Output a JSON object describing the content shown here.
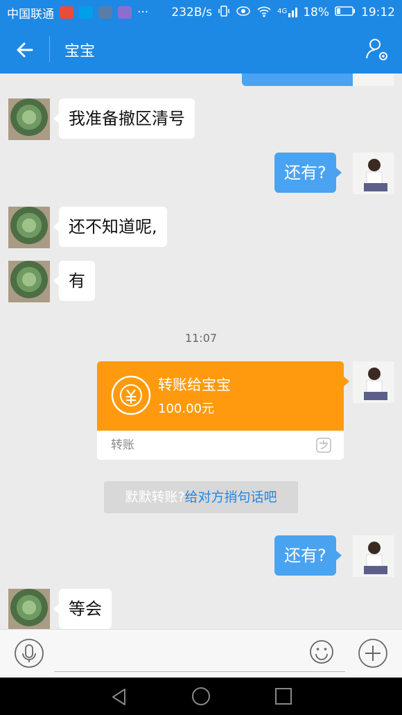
{
  "status_bar": {
    "carrier": "中国联通",
    "speed": "232B/s",
    "network": "4G",
    "battery": "18%",
    "time": "19:12",
    "more": "···"
  },
  "header": {
    "title": "宝宝"
  },
  "messages": [
    {
      "side": "left",
      "text": "我准备撤区清号"
    },
    {
      "side": "right",
      "text": "还有?"
    },
    {
      "side": "left",
      "text": "还不知道呢,"
    },
    {
      "side": "left",
      "text": "有"
    },
    {
      "side": "right",
      "text": "还有?"
    },
    {
      "side": "left",
      "text": "等会"
    }
  ],
  "timestamp": "11:07",
  "transfer": {
    "title": "转账给宝宝",
    "amount": "100.00元",
    "footer": "转账"
  },
  "hint": {
    "prefix": "默默转账?",
    "link": "给对方捎句话吧"
  },
  "icons": {
    "accent": "#1e88e5",
    "bubble_right": "#4aa3f0",
    "transfer": "#ff9a0e"
  }
}
